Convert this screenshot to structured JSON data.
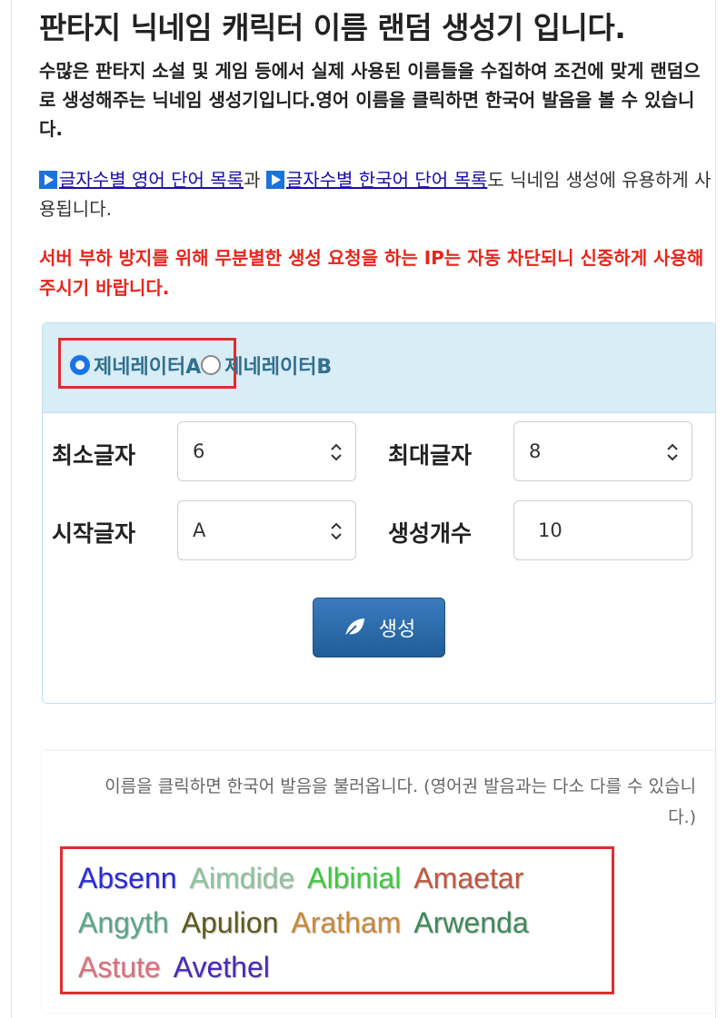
{
  "title": "판타지 닉네임 캐릭터 이름 랜덤 생성기 입니다.",
  "intro": "수많은 판타지 소설 및 게임 등에서 실제 사용된 이름들을 수집하여 조건에 맞게 랜덤으로 생성해주는 닉네임 생성기입니다.영어 이름을 클릭하면 한국어 발음을 볼 수 있습니다.",
  "links": {
    "english_link": "글자수별 영어 단어 목록",
    "conj1": "과 ",
    "korean_link": "글자수별 한국어 단어 목록",
    "rest": "도 닉네임 생성에 유용하게 사용됩니다."
  },
  "warning": "서버 부하 방지를 위해 무분별한 생성 요청을 하는 IP는 자동 차단되니 신중하게 사용해주시기 바랍니다.",
  "generator": {
    "options": [
      {
        "label": "제네레이터A",
        "checked": true
      },
      {
        "label": "제네레이터B",
        "checked": false
      }
    ],
    "min_chars": {
      "label": "최소글자",
      "value": "6"
    },
    "max_chars": {
      "label": "최대글자",
      "value": "8"
    },
    "start_char": {
      "label": "시작글자",
      "value": "A"
    },
    "count": {
      "label": "생성개수",
      "value": "10"
    },
    "button_label": "생성",
    "button_icon": "leaf-icon"
  },
  "result": {
    "hint": "이름을 클릭하면 한국어 발음을 불러옵니다. (영어권 발음과는 다소 다를 수 있습니다.)",
    "names": [
      {
        "text": "Absenn",
        "color": "#2a2ad6"
      },
      {
        "text": "Aimdide",
        "color": "#8fc39a"
      },
      {
        "text": "Albinial",
        "color": "#3ec93e"
      },
      {
        "text": "Amaetar",
        "color": "#c0583e"
      },
      {
        "text": "Angyth",
        "color": "#5aa688"
      },
      {
        "text": "Apulion",
        "color": "#5d5a1e"
      },
      {
        "text": "Aratham",
        "color": "#c8893a"
      },
      {
        "text": "Arwenda",
        "color": "#3f8a5a"
      },
      {
        "text": "Astute",
        "color": "#d9707e"
      },
      {
        "text": "Avethel",
        "color": "#4a2ab8"
      }
    ]
  }
}
